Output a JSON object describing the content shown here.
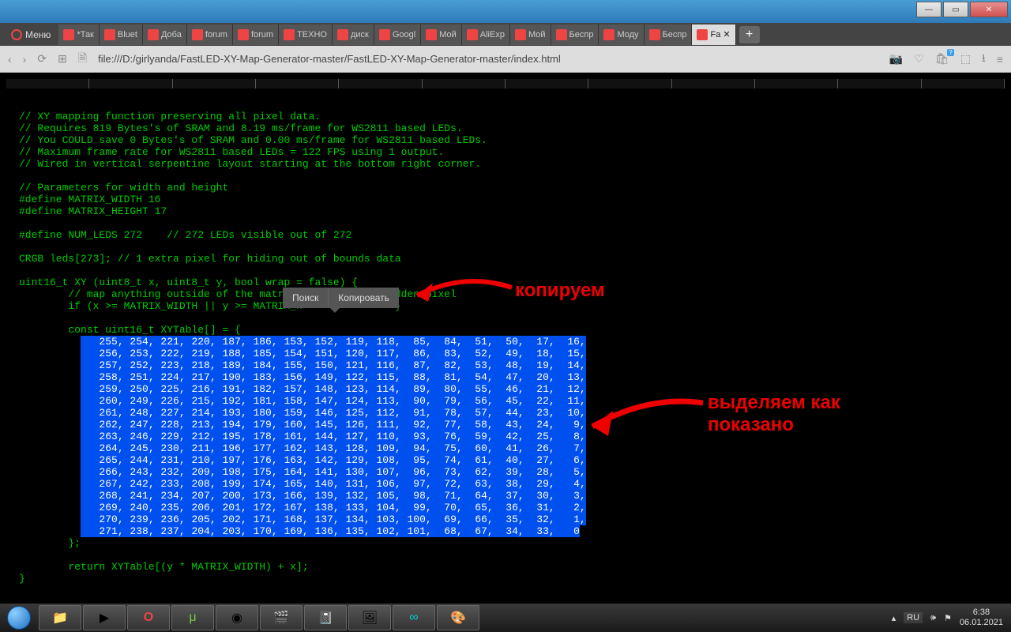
{
  "window": {
    "min": "—",
    "max": "▭",
    "close": "✕"
  },
  "menu_label": "Меню",
  "tabs": [
    {
      "label": "*Так"
    },
    {
      "label": "Bluet"
    },
    {
      "label": "Доба"
    },
    {
      "label": "forum"
    },
    {
      "label": "forum"
    },
    {
      "label": "ТЕХНО"
    },
    {
      "label": "диск"
    },
    {
      "label": "Googl"
    },
    {
      "label": "Мой"
    },
    {
      "label": "AliExp"
    },
    {
      "label": "Мой"
    },
    {
      "label": "Беспр"
    },
    {
      "label": "Моду"
    },
    {
      "label": "Беспр"
    },
    {
      "label": "Fa"
    }
  ],
  "newtab": "+",
  "address": "file:///D:/girlyanda/FastLED-XY-Map-Generator-master/FastLED-XY-Map-Generator-master/index.html",
  "context_menu": {
    "search": "Поиск",
    "copy": "Копировать"
  },
  "annotations": {
    "a1": "копируем",
    "a2": "выделяем как показано",
    "a2_l1": "выделяем как",
    "a2_l2": "показано"
  },
  "code": {
    "comments": [
      "// XY mapping function preserving all pixel data.",
      "// Requires 819 Bytes's of SRAM and 8.19 ms/frame for WS2811 based LEDs.",
      "// You COULD save 0 Bytes's of SRAM and 0.00 ms/frame for WS2811 based LEDs.",
      "// Maximum frame rate for WS2811 based LEDs = 122 FPS using 1 output.",
      "// Wired in vertical serpentine layout starting at the bottom right corner."
    ],
    "params_comment": "// Parameters for width and height",
    "def_w": "#define MATRIX_WIDTH 16",
    "def_h": "#define MATRIX_HEIGHT 17",
    "def_n": "#define NUM_LEDS 272    // 272 LEDs visible out of 272",
    "crgb": "CRGB leds[273]; // 1 extra pixel for hiding out of bounds data",
    "fn": "uint16_t XY (uint8_t x, uint8_t y, bool wrap = false) {",
    "map_c": "        // map anything outside of the matrix to the extra hidden pixel",
    "if_line_pre": "        if (x >= MATRIX_WIDTH || y >= MATRIX_H",
    "if_line_post": "               }",
    "tbl": "        const uint16_t XYTable[] = {",
    "rows": [
      "   255, 254, 221, 220, 187, 186, 153, 152, 119, 118,  85,  84,  51,  50,  17,  16,",
      "   256, 253, 222, 219, 188, 185, 154, 151, 120, 117,  86,  83,  52,  49,  18,  15,",
      "   257, 252, 223, 218, 189, 184, 155, 150, 121, 116,  87,  82,  53,  48,  19,  14,",
      "   258, 251, 224, 217, 190, 183, 156, 149, 122, 115,  88,  81,  54,  47,  20,  13,",
      "   259, 250, 225, 216, 191, 182, 157, 148, 123, 114,  89,  80,  55,  46,  21,  12,",
      "   260, 249, 226, 215, 192, 181, 158, 147, 124, 113,  90,  79,  56,  45,  22,  11,",
      "   261, 248, 227, 214, 193, 180, 159, 146, 125, 112,  91,  78,  57,  44,  23,  10,",
      "   262, 247, 228, 213, 194, 179, 160, 145, 126, 111,  92,  77,  58,  43,  24,   9,",
      "   263, 246, 229, 212, 195, 178, 161, 144, 127, 110,  93,  76,  59,  42,  25,   8,",
      "   264, 245, 230, 211, 196, 177, 162, 143, 128, 109,  94,  75,  60,  41,  26,   7,",
      "   265, 244, 231, 210, 197, 176, 163, 142, 129, 108,  95,  74,  61,  40,  27,   6,",
      "   266, 243, 232, 209, 198, 175, 164, 141, 130, 107,  96,  73,  62,  39,  28,   5,",
      "   267, 242, 233, 208, 199, 174, 165, 140, 131, 106,  97,  72,  63,  38,  29,   4,",
      "   268, 241, 234, 207, 200, 173, 166, 139, 132, 105,  98,  71,  64,  37,  30,   3,",
      "   269, 240, 235, 206, 201, 172, 167, 138, 133, 104,  99,  70,  65,  36,  31,   2,",
      "   270, 239, 236, 205, 202, 171, 168, 137, 134, 103, 100,  69,  66,  35,  32,   1,",
      "   271, 238, 237, 204, 203, 170, 169, 136, 135, 102, 101,  68,  67,  34,  33,   0"
    ],
    "row_prefix": "          ",
    "close_tbl": "        };",
    "ret": "        return XYTable[(y * MATRIX_WIDTH) + x];",
    "close_fn": "}"
  },
  "tray": {
    "lang": "RU",
    "time": "6:38",
    "date": "06.01.2021"
  }
}
